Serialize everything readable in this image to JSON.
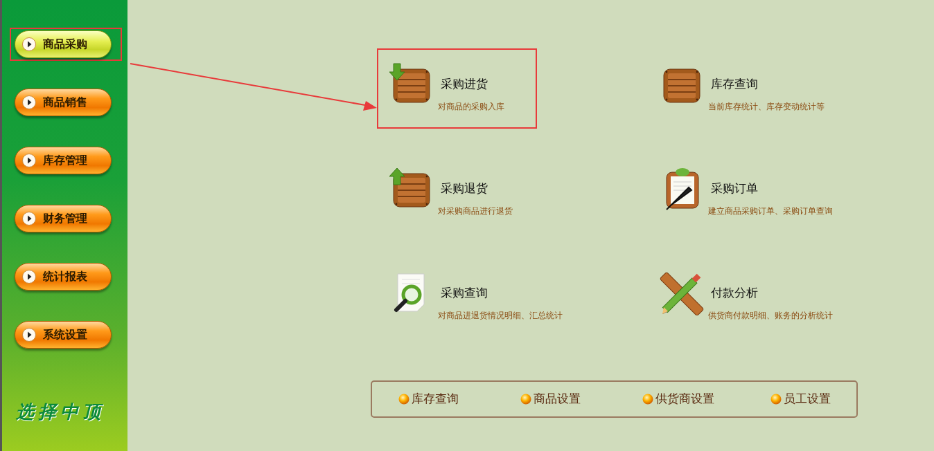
{
  "sidebar": {
    "items": [
      {
        "label": "商品采购",
        "selected": true,
        "highlighted": true
      },
      {
        "label": "商品销售",
        "selected": false
      },
      {
        "label": "库存管理",
        "selected": false
      },
      {
        "label": "财务管理",
        "selected": false
      },
      {
        "label": "统计报表",
        "selected": false
      },
      {
        "label": "系统设置",
        "selected": false
      }
    ],
    "slogan": "选择中顶"
  },
  "tiles": [
    {
      "kind": "crate-in",
      "title": "采购进货",
      "description": "对商品的采购入库",
      "highlighted": true
    },
    {
      "kind": "crate",
      "title": "库存查询",
      "description": "当前库存统计、库存变动统计等"
    },
    {
      "kind": "crate-out",
      "title": "采购退货",
      "description": "对采购商品进行退货"
    },
    {
      "kind": "clipboard",
      "title": "采购订单",
      "description": "建立商品采购订单、采购订单查询"
    },
    {
      "kind": "search-doc",
      "title": "采购查询",
      "description": "对商品进退货情况明细、汇总统计"
    },
    {
      "kind": "pencil-ruler",
      "title": "付款分析",
      "description": "供货商付款明细、账务的分析统计"
    }
  ],
  "quick_links": [
    "库存查询",
    "商品设置",
    "供货商设置",
    "员工设置"
  ]
}
